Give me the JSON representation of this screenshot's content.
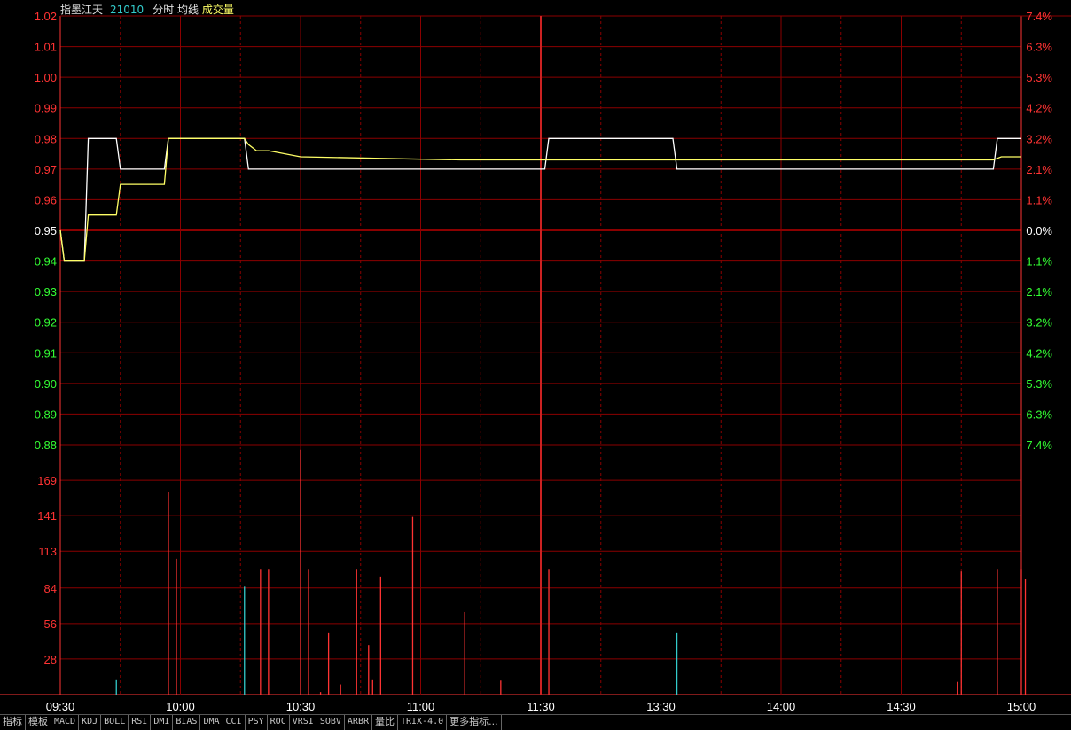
{
  "header": {
    "name": "指墨江天",
    "code": "21010",
    "indicators": "分时 均线",
    "volume_label": "成交量"
  },
  "colors": {
    "background": "#000000",
    "grid": "#8b0000",
    "up": "#ff3333",
    "down": "#33ff33",
    "neutral": "#ffffff",
    "price_line": "#ffffff",
    "avg_line": "#ffff66",
    "vol_up": "#ff3333",
    "vol_down": "#33cccc"
  },
  "price_axis": {
    "labels": [
      "1.02",
      "1.01",
      "1.00",
      "0.99",
      "0.98",
      "0.97",
      "0.96",
      "0.95",
      "0.94",
      "0.93",
      "0.92",
      "0.91",
      "0.90",
      "0.89",
      "0.88"
    ],
    "pct_labels": [
      "7.4%",
      "6.3%",
      "5.3%",
      "4.2%",
      "3.2%",
      "2.1%",
      "1.1%",
      "0.0%",
      "1.1%",
      "2.1%",
      "3.2%",
      "4.2%",
      "5.3%",
      "6.3%",
      "7.4%"
    ],
    "prev_close": 0.95
  },
  "volume_axis": {
    "labels": [
      "169",
      "141",
      "113",
      "84",
      "56",
      "28"
    ]
  },
  "time_axis": {
    "labels": [
      "09:30",
      "10:00",
      "10:30",
      "11:00",
      "11:30",
      "13:30",
      "14:00",
      "14:30",
      "15:00"
    ]
  },
  "chart_data": [
    {
      "type": "line",
      "title": "",
      "x_unit": "trading minute (0 = 09:30, 120 = 11:30/13:00, 240 = 15:00)",
      "ylim": [
        0.88,
        1.02
      ],
      "series": [
        {
          "name": "分时",
          "points": [
            [
              0,
              0.95
            ],
            [
              1,
              0.94
            ],
            [
              6,
              0.94
            ],
            [
              7,
              0.98
            ],
            [
              14,
              0.98
            ],
            [
              15,
              0.97
            ],
            [
              26,
              0.97
            ],
            [
              27,
              0.98
            ],
            [
              46,
              0.98
            ],
            [
              47,
              0.97
            ],
            [
              121,
              0.97
            ],
            [
              122,
              0.98
            ],
            [
              153,
              0.98
            ],
            [
              154,
              0.97
            ],
            [
              233,
              0.97
            ],
            [
              234,
              0.98
            ],
            [
              240,
              0.98
            ]
          ]
        },
        {
          "name": "均线",
          "points": [
            [
              0,
              0.95
            ],
            [
              1,
              0.94
            ],
            [
              6,
              0.94
            ],
            [
              7,
              0.955
            ],
            [
              14,
              0.955
            ],
            [
              15,
              0.965
            ],
            [
              26,
              0.965
            ],
            [
              27,
              0.98
            ],
            [
              46,
              0.98
            ],
            [
              47,
              0.978
            ],
            [
              49,
              0.976
            ],
            [
              52,
              0.976
            ],
            [
              60,
              0.974
            ],
            [
              80,
              0.9735
            ],
            [
              100,
              0.973
            ],
            [
              120,
              0.973
            ],
            [
              150,
              0.973
            ],
            [
              200,
              0.973
            ],
            [
              233,
              0.973
            ],
            [
              235,
              0.974
            ],
            [
              240,
              0.974
            ]
          ]
        }
      ]
    },
    {
      "type": "bar",
      "title": "成交量",
      "ylim": [
        0,
        197
      ],
      "bars": [
        {
          "t": 14,
          "v": 12,
          "dir": "down"
        },
        {
          "t": 27,
          "v": 160,
          "dir": "up"
        },
        {
          "t": 29,
          "v": 107,
          "dir": "up"
        },
        {
          "t": 46,
          "v": 85,
          "dir": "down"
        },
        {
          "t": 50,
          "v": 99,
          "dir": "up"
        },
        {
          "t": 52,
          "v": 99,
          "dir": "up"
        },
        {
          "t": 60,
          "v": 193,
          "dir": "up"
        },
        {
          "t": 62,
          "v": 99,
          "dir": "up"
        },
        {
          "t": 65,
          "v": 2,
          "dir": "up"
        },
        {
          "t": 67,
          "v": 49,
          "dir": "up"
        },
        {
          "t": 70,
          "v": 8,
          "dir": "up"
        },
        {
          "t": 74,
          "v": 99,
          "dir": "up"
        },
        {
          "t": 77,
          "v": 39,
          "dir": "up"
        },
        {
          "t": 78,
          "v": 12,
          "dir": "up"
        },
        {
          "t": 80,
          "v": 93,
          "dir": "up"
        },
        {
          "t": 88,
          "v": 140,
          "dir": "up"
        },
        {
          "t": 101,
          "v": 65,
          "dir": "up"
        },
        {
          "t": 110,
          "v": 11,
          "dir": "up"
        },
        {
          "t": 122,
          "v": 99,
          "dir": "up"
        },
        {
          "t": 154,
          "v": 49,
          "dir": "down"
        },
        {
          "t": 224,
          "v": 10,
          "dir": "up"
        },
        {
          "t": 225,
          "v": 97,
          "dir": "up"
        },
        {
          "t": 234,
          "v": 99,
          "dir": "up"
        },
        {
          "t": 240,
          "v": 99,
          "dir": "up"
        },
        {
          "t": 241,
          "v": 91,
          "dir": "up"
        }
      ]
    }
  ],
  "tabs": [
    "指标",
    "模板",
    "MACD",
    "KDJ",
    "BOLL",
    "RSI",
    "DMI",
    "BIAS",
    "DMA",
    "CCI",
    "PSY",
    "ROC",
    "VRSI",
    "SOBV",
    "ARBR",
    "量比",
    "TRIX-4.0",
    "更多指标..."
  ]
}
